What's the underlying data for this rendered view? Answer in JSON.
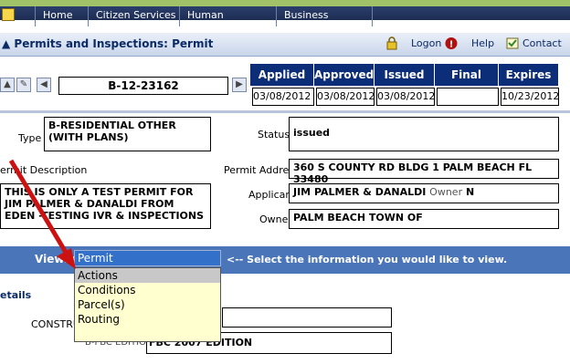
{
  "nav": {
    "tabs": [
      "Home",
      "Citizen Services",
      "Human Resources",
      "Business Services"
    ]
  },
  "header": {
    "title": "Permits and Inspections: Permit",
    "logon": "Logon",
    "help": "Help",
    "contact": "Contact"
  },
  "record": {
    "id": "B-12-23162"
  },
  "dates": {
    "headers": [
      "Applied",
      "Approved",
      "Issued",
      "Final",
      "Expires"
    ],
    "values": [
      "03/08/2012",
      "03/08/2012",
      "03/08/2012",
      "",
      "10/23/2012"
    ]
  },
  "details": {
    "type_label": "Type",
    "type_value": "B-RESIDENTIAL OTHER (WITH PLANS)",
    "status_label": "Status",
    "status_value": "issued",
    "desc_label": "ermit Description",
    "desc_value": "THIS IS ONLY A TEST PERMIT FOR JIM PALMER & DANALDI FROM EDEN -TESTING IVR & INSPECTIONS",
    "address_label": "Permit Address",
    "address_value": "360 S COUNTY RD BLDG 1 PALM BEACH FL 33480",
    "applicant_label": "Applicant",
    "applicant_value": "JIM PALMER & DANALDI",
    "owner_inline_label": "Owner",
    "owner_inline_value": "N",
    "owner_label": "Owner",
    "owner_value": "PALM BEACH TOWN OF"
  },
  "viewing": {
    "label": "Viewing",
    "selected": "Permit",
    "hint": "<-- Select the information you would like to view.",
    "options": [
      "Actions",
      "Conditions",
      "Parcel(s)",
      "Routing"
    ]
  },
  "bottom": {
    "details_title": "etails",
    "construct_label": "CONSTRUC",
    "edition_label": "B-FBC EDITION",
    "edition_value": "FBC 2007 EDITION"
  },
  "colors": {
    "nav_bg": "#1d2c52",
    "date_header_bg": "#0c2d78",
    "viewbar_bg": "#4a75b9",
    "dropdown_bg": "#ffffcf",
    "arrow": "#cc1111"
  }
}
